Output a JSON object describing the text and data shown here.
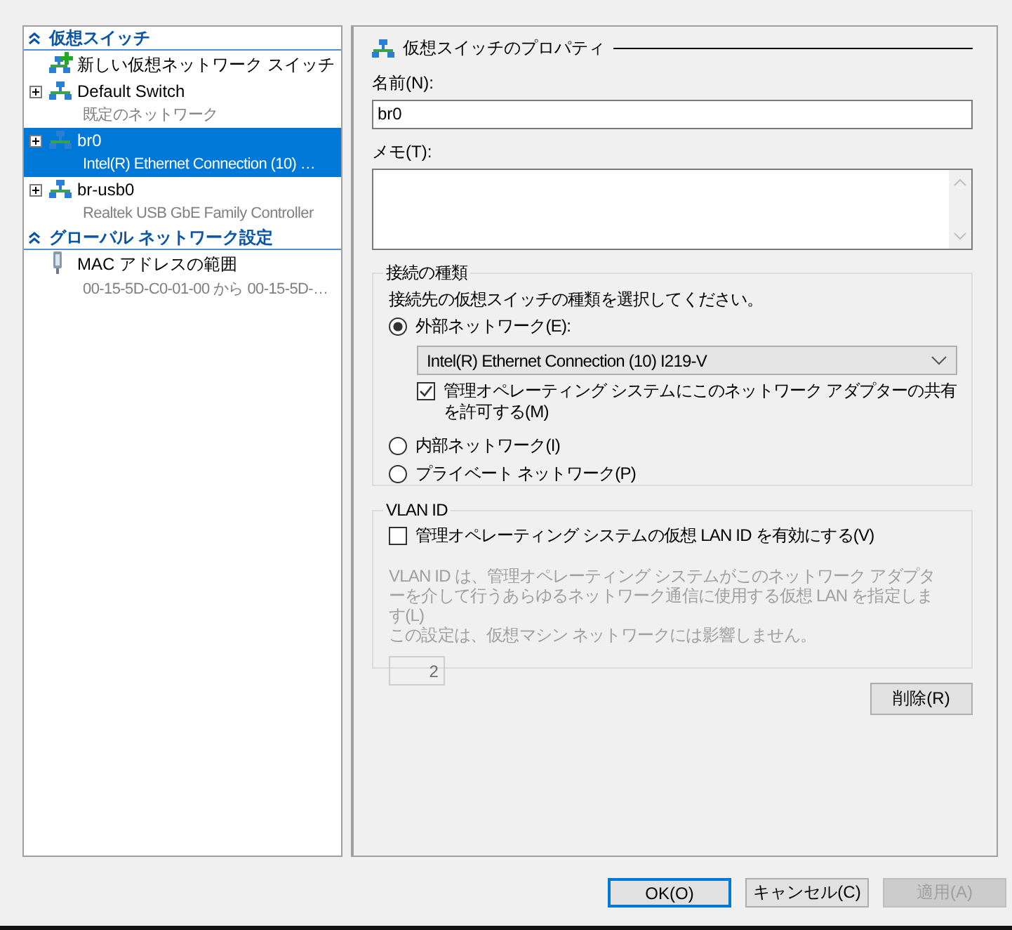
{
  "sidebar": {
    "sections": [
      {
        "title": "仮想スイッチ",
        "expanded": true,
        "items": [
          {
            "kind": "new-switch",
            "label": "新しい仮想ネットワーク スイッチ",
            "selected": false
          },
          {
            "kind": "switch",
            "label": "Default Switch",
            "detail": "既定のネットワーク",
            "selected": false,
            "expanded": false
          },
          {
            "kind": "switch",
            "label": "br0",
            "detail": "Intel(R) Ethernet Connection (10) …",
            "selected": true,
            "expanded": false
          },
          {
            "kind": "switch",
            "label": "br-usb0",
            "detail": "Realtek USB GbE Family Controller",
            "selected": false,
            "expanded": false
          }
        ]
      },
      {
        "title": "グローバル ネットワーク設定",
        "expanded": true,
        "items": [
          {
            "kind": "mac",
            "label": "MAC アドレスの範囲",
            "detail": "00-15-5D-C0-01-00 から 00-15-5D-…",
            "selected": false
          }
        ]
      }
    ]
  },
  "properties": {
    "title": "仮想スイッチのプロパティ",
    "name_label": "名前(N):",
    "name_value": "br0",
    "notes_label": "メモ(T):",
    "connection": {
      "legend": "接続の種類",
      "prompt": "接続先の仮想スイッチの種類を選択してください。",
      "options": [
        {
          "label": "外部ネットワーク(E):",
          "selected": true
        },
        {
          "label": "内部ネットワーク(I)",
          "selected": false
        },
        {
          "label": "プライベート ネットワーク(P)",
          "selected": false
        }
      ],
      "adapter": "Intel(R) Ethernet Connection (10) I219-V",
      "share": {
        "label": "管理オペレーティング システムにこのネットワーク アダプターの共有を許可する(M)",
        "checked": true
      }
    },
    "vlan": {
      "legend": "VLAN ID",
      "enable": {
        "label": "管理オペレーティング システムの仮想 LAN ID を有効にする(V)",
        "checked": false
      },
      "description": [
        "VLAN ID は、管理オペレーティング システムがこのネットワーク アダプターを介して行うあらゆるネットワーク通信に使用する仮想 LAN を指定します(L)",
        "この設定は、仮想マシン ネットワークには影響しません。"
      ],
      "value": "2",
      "disabled": true
    },
    "remove_button": "削除(R)"
  },
  "buttons": [
    {
      "label": "OK(O)",
      "default": true,
      "disabled": false
    },
    {
      "label": "キャンセル(C)",
      "default": false,
      "disabled": false
    },
    {
      "label": "適用(A)",
      "default": false,
      "disabled": true
    }
  ]
}
